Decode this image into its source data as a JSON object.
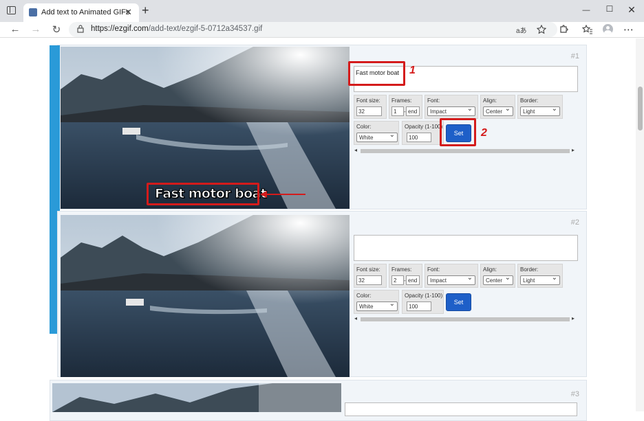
{
  "browser": {
    "tab_title": "Add text to Animated GIFs",
    "tab_close": "✕",
    "new_tab": "+",
    "url_host": "https://ezgif.com",
    "url_path": "/add-text/ezgif-5-0712a34537.gif",
    "minimize": "—",
    "maximize": "☐",
    "close": "✕",
    "back": "←",
    "forward": "→",
    "reload": "↻",
    "read_aloud": "aあ",
    "menu": "⋯"
  },
  "frames": [
    {
      "number": "#1",
      "text_value": "Fast motor boat",
      "overlay_text": "Fast motor boat",
      "font_size_label": "Font size:",
      "font_size": "32",
      "frames_label": "Frames:",
      "frames_from": "1",
      "frames_sep": "-",
      "frames_to": "end",
      "font_label": "Font:",
      "font_value": "Impact",
      "align_label": "Align:",
      "align_value": "Center",
      "border_label": "Border:",
      "border_value": "Light",
      "color_label": "Color:",
      "color_value": "White",
      "opacity_label": "Opacity (1-100):",
      "opacity": "100",
      "set_label": "Set"
    },
    {
      "number": "#2",
      "text_value": "",
      "font_size_label": "Font size:",
      "font_size": "32",
      "frames_label": "Frames:",
      "frames_from": "2",
      "frames_sep": "-",
      "frames_to": "end",
      "font_label": "Font:",
      "font_value": "Impact",
      "align_label": "Align:",
      "align_value": "Center",
      "border_label": "Border:",
      "border_value": "Light",
      "color_label": "Color:",
      "color_value": "White",
      "opacity_label": "Opacity (1-100):",
      "opacity": "100",
      "set_label": "Set"
    },
    {
      "number": "#3"
    }
  ],
  "annotations": {
    "step1": "1",
    "step2": "2"
  },
  "colors": {
    "accent_red": "#d41b1b",
    "set_button": "#1e5fc8"
  }
}
